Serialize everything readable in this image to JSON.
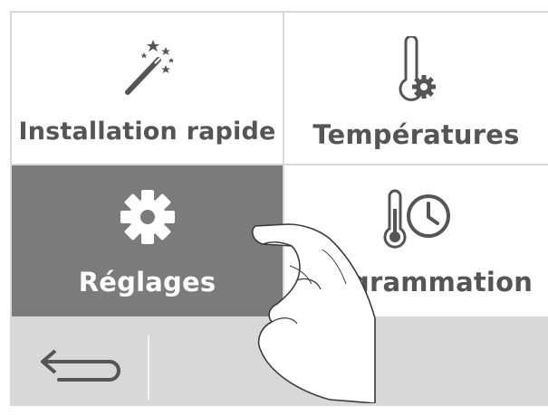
{
  "menu": {
    "tiles": [
      {
        "label": "Installation rapide",
        "icon": "magic-wand-icon",
        "selected": false
      },
      {
        "label": "Températures",
        "icon": "thermometer-gear-icon",
        "selected": false
      },
      {
        "label": "Réglages",
        "icon": "gear-icon",
        "selected": true
      },
      {
        "label": "Programmation",
        "icon": "thermometer-clock-icon",
        "selected": false
      }
    ]
  },
  "bottom_bar": {
    "back_icon": "back-arrow-icon"
  },
  "overlay": {
    "icon": "pointing-hand-icon"
  },
  "colors": {
    "tile_background": "#ffffff",
    "selected_tile": "#7b7b7b",
    "bar_background": "#d8d8d8",
    "label_text": "#555555",
    "selected_label_text": "#ffffff"
  }
}
